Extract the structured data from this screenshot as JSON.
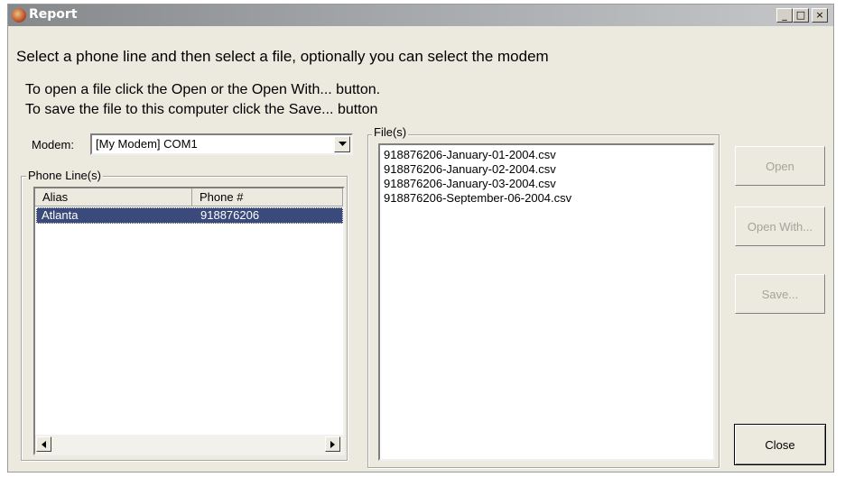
{
  "window": {
    "title": "Report",
    "minimize": "_",
    "maximize": "□",
    "close": "×"
  },
  "instructions": {
    "line1": "Select a phone line and then select a file, optionally you can select the modem",
    "line2": "To open a file click the Open or the Open With... button.",
    "line3": "To save the file to this computer click the Save... button"
  },
  "modem": {
    "label": "Modem:",
    "value": "[My Modem] COM1"
  },
  "phone_lines": {
    "group_label": "Phone Line(s)",
    "columns": [
      "Alias",
      "Phone #"
    ],
    "rows": [
      {
        "alias": "Atlanta",
        "phone": "918876206",
        "selected": true
      }
    ]
  },
  "files": {
    "group_label": "File(s)",
    "items": [
      "918876206-January-01-2004.csv",
      "918876206-January-02-2004.csv",
      "918876206-January-03-2004.csv",
      "918876206-September-06-2004.csv"
    ]
  },
  "buttons": {
    "open": "Open",
    "open_with": "Open With...",
    "save": "Save...",
    "close": "Close"
  },
  "colors": {
    "selection": "#3a4a7a",
    "window_bg": "#ece9df"
  }
}
